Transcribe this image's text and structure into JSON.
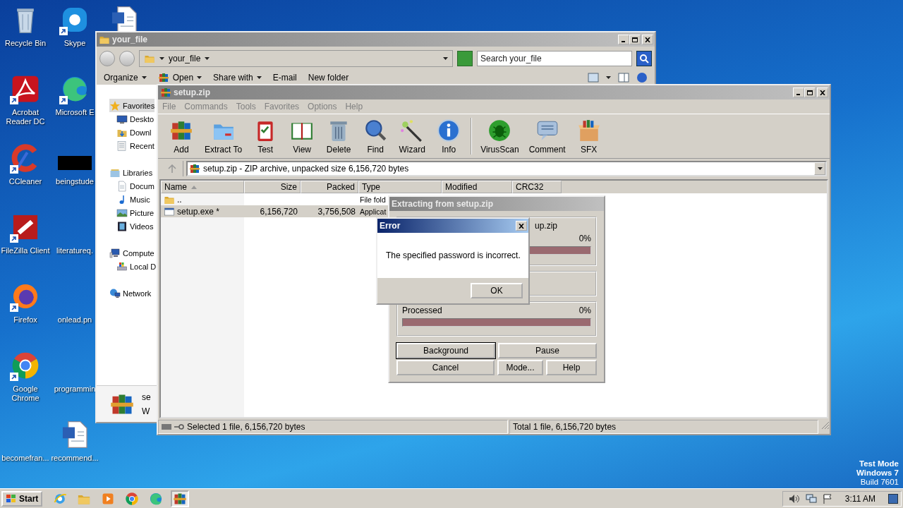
{
  "desktop": {
    "icons": [
      {
        "label": "Recycle Bin",
        "kind": "recycle",
        "shortcut": false
      },
      {
        "label": "Acrobat Reader DC",
        "kind": "acrobat",
        "shortcut": true
      },
      {
        "label": "CCleaner",
        "kind": "ccleaner",
        "shortcut": true
      },
      {
        "label": "FileZilla Client",
        "kind": "filezilla",
        "shortcut": true
      },
      {
        "label": "Firefox",
        "kind": "firefox",
        "shortcut": true
      },
      {
        "label": "Google Chrome",
        "kind": "chrome",
        "shortcut": true
      },
      {
        "label": "becomefran...",
        "kind": "blank",
        "shortcut": false
      },
      {
        "label": "Skype",
        "kind": "skype",
        "shortcut": true
      },
      {
        "label": "Microsoft E",
        "kind": "edge",
        "shortcut": true
      },
      {
        "label": "beingstude",
        "kind": "redacted",
        "shortcut": false
      },
      {
        "label": "literatureq.",
        "kind": "blank",
        "shortcut": false
      },
      {
        "label": "onlead.pn",
        "kind": "blank",
        "shortcut": false
      },
      {
        "label": "programmin",
        "kind": "blank",
        "shortcut": false
      },
      {
        "label": "recommend...",
        "kind": "word",
        "shortcut": false
      },
      {
        "kind": "word",
        "shortcut": false
      }
    ],
    "watermark": [
      "Test Mode",
      "Windows 7",
      "Build 7601"
    ]
  },
  "explorer": {
    "title": "your_file",
    "active": false,
    "breadcrumb": "your_file",
    "search": {
      "placeholder": "Search your_file"
    },
    "toolbar": [
      {
        "label": "Organize",
        "kind": "plain",
        "dropdown": true
      },
      {
        "label": "Open",
        "kind": "archive",
        "dropdown": true
      },
      {
        "label": "Share with",
        "kind": "plain",
        "dropdown": true
      },
      {
        "label": "E-mail",
        "kind": "plain",
        "dropdown": false
      },
      {
        "label": "New folder",
        "kind": "plain",
        "dropdown": false
      }
    ],
    "nav": [
      {
        "label": "Favorites",
        "kind": "star",
        "selected": true,
        "children": [
          {
            "label": "Deskto",
            "kind": "desktop",
            "selected": false
          },
          {
            "label": "Downl",
            "kind": "downloads",
            "selected": false
          },
          {
            "label": "Recent",
            "kind": "recent",
            "selected": false
          }
        ]
      },
      {
        "label": "Libraries",
        "kind": "library",
        "selected": false,
        "children": [
          {
            "label": "Docum",
            "kind": "document",
            "selected": false
          },
          {
            "label": "Music",
            "kind": "music",
            "selected": false
          },
          {
            "label": "Picture",
            "kind": "picture",
            "selected": false
          },
          {
            "label": "Videos",
            "kind": "video",
            "selected": false
          }
        ]
      },
      {
        "label": "Compute",
        "kind": "computer",
        "selected": false,
        "children": [
          {
            "label": "Local D",
            "kind": "drive",
            "selected": false
          }
        ]
      },
      {
        "label": "Network",
        "kind": "network",
        "selected": false
      }
    ],
    "details": [
      "se",
      "W"
    ]
  },
  "winrar": {
    "title": "setup.zip",
    "active": false,
    "menu": [
      "File",
      "Commands",
      "Tools",
      "Favorites",
      "Options",
      "Help"
    ],
    "toolbar": [
      {
        "label": "Add",
        "kind": "add"
      },
      {
        "label": "Extract To",
        "kind": "extract"
      },
      {
        "label": "Test",
        "kind": "test"
      },
      {
        "label": "View",
        "kind": "view"
      },
      {
        "label": "Delete",
        "kind": "delete"
      },
      {
        "label": "Find",
        "kind": "find"
      },
      {
        "label": "Wizard",
        "kind": "wizard"
      },
      {
        "label": "Info",
        "kind": "info"
      },
      {
        "kind": "separator"
      },
      {
        "label": "VirusScan",
        "kind": "virusscan"
      },
      {
        "label": "Comment",
        "kind": "comment"
      },
      {
        "label": "SFX",
        "kind": "sfx"
      }
    ],
    "path": "setup.zip - ZIP archive, unpacked size 6,156,720 bytes",
    "columns": [
      {
        "label": "Name",
        "sorted": true
      },
      {
        "label": "Size",
        "sorted": false
      },
      {
        "label": "Packed",
        "sorted": false
      },
      {
        "label": "Type",
        "sorted": false
      },
      {
        "label": "Modified",
        "sorted": false
      },
      {
        "label": "CRC32",
        "sorted": false
      }
    ],
    "rows": [
      {
        "kind": "folder",
        "name": "..",
        "type": "File fold",
        "selected": false
      },
      {
        "kind": "exe",
        "name": "setup.exe *",
        "size": "6,156,720",
        "packed": "3,756,508",
        "type": "Applicat",
        "selected": true
      }
    ],
    "status": [
      "Selected 1 file, 6,156,720 bytes",
      "Total 1 file, 6,156,720 bytes"
    ]
  },
  "extract_dialog": {
    "title": "Extracting from setup.zip",
    "active": false,
    "archive": "up.zip",
    "archive_percent": "0%",
    "archive_progress": {
      "level": 0
    },
    "processed_label": "Processed",
    "processed_percent": "0%",
    "processed_progress": {
      "level": 0
    },
    "button_rows": [
      [
        {
          "label": "Background",
          "default": true
        },
        {
          "label": "Pause",
          "default": false
        }
      ],
      [
        {
          "label": "Cancel",
          "default": false
        },
        {
          "label": "Mode...",
          "default": false
        },
        {
          "label": "Help",
          "default": false
        }
      ]
    ]
  },
  "error_dialog": {
    "title": "Error",
    "active": true,
    "message": "The specified password is incorrect.",
    "button": "OK"
  },
  "taskbar": {
    "start": "Start",
    "apps": [
      {
        "kind": "ie",
        "selected": false
      },
      {
        "kind": "explorer",
        "selected": false
      },
      {
        "kind": "media",
        "selected": false
      },
      {
        "kind": "chrome",
        "selected": false
      },
      {
        "kind": "edge",
        "selected": false
      },
      {
        "kind": "archive",
        "selected": true
      }
    ],
    "clock": "3:11 AM"
  }
}
